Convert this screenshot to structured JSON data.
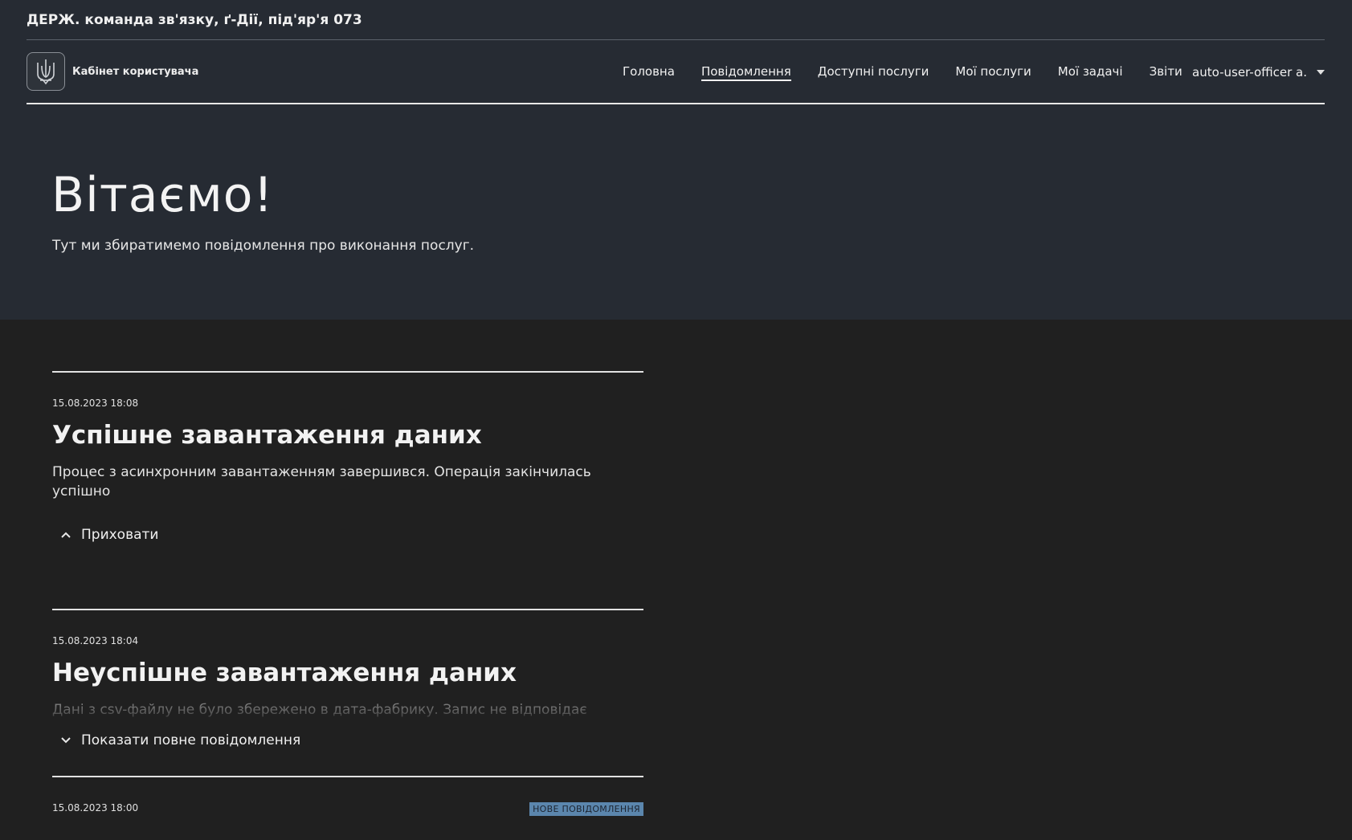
{
  "org": {
    "title": "ДЕРЖ. команда зв'язку, ґ-Дії, під'яр'я 073"
  },
  "brand": {
    "logo_icon": "trident-icon",
    "label": "Кабінет користувача"
  },
  "nav": {
    "items": [
      {
        "label": "Головна",
        "active": false
      },
      {
        "label": "Повідомлення",
        "active": true
      },
      {
        "label": "Доступні послуги",
        "active": false
      },
      {
        "label": "Мої послуги",
        "active": false
      },
      {
        "label": "Мої задачі",
        "active": false
      },
      {
        "label": "Звіти",
        "active": false
      }
    ]
  },
  "user": {
    "name": "auto-user-officer a.",
    "menu_icon": "caret-down-icon"
  },
  "hero": {
    "title": "Вітаємо!",
    "subtitle": "Тут ми збиратимемо повідомлення про виконання послуг."
  },
  "notifications": [
    {
      "date": "15.08.2023 18:08",
      "title": "Успішне завантаження даних",
      "body": "Процес з асинхронним завантаженням завершився. Операція закінчилась успішно",
      "toggle_label": "Приховати",
      "expanded": true
    },
    {
      "date": "15.08.2023 18:04",
      "title": "Неуспішне завантаження даних",
      "body": "Дані з csv-файлу не було збережено в дата-фабрику. Запис не відповідає",
      "toggle_label": "Показати повне повідомлення",
      "expanded": false
    },
    {
      "date": "15.08.2023 18:00",
      "badge": "НОВЕ ПОВІДОМЛЕННЯ"
    }
  ],
  "colors": {
    "header_bg": "#262b33",
    "page_bg": "#202020",
    "badge_bg": "#5b86ad"
  }
}
